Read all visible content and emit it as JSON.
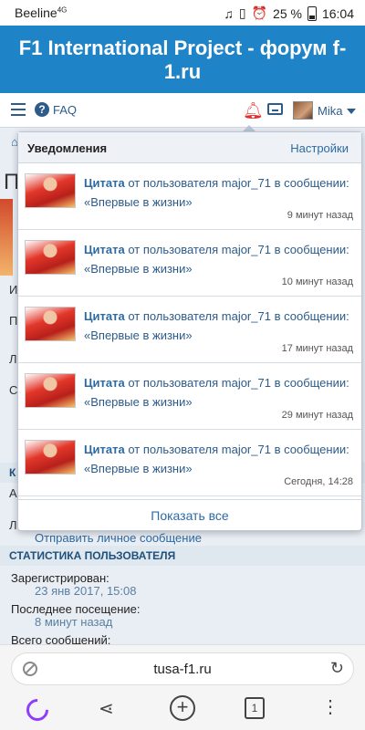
{
  "status_bar": {
    "carrier": "Beeline",
    "network": "4G",
    "battery": "25 %",
    "time": "16:04"
  },
  "header": {
    "title": "F1 International Project - форум f-1.ru"
  },
  "nav": {
    "faq": "FAQ",
    "username": "Mika",
    "icons": [
      "menu-icon",
      "help-circle-icon",
      "bell-icon",
      "inbox-icon",
      "avatar",
      "chevron-down-icon"
    ]
  },
  "page": {
    "peek_letters": [
      "П",
      "И",
      "П",
      "Л",
      "С",
      "К",
      "А",
      "Л"
    ],
    "send_pm": "Отправить личное сообщение",
    "stats_header": "Статистика пользователя",
    "registered_label": "Зарегистрирован:",
    "registered_value": "23 янв 2017, 15:08",
    "last_visit_label": "Последнее посещение:",
    "last_visit_value": "8 минут назад",
    "total_posts_label": "Всего сообщений:"
  },
  "notifications": {
    "title": "Уведомления",
    "settings": "Настройки",
    "show_all": "Показать все",
    "items": [
      {
        "kind": "Цитата",
        "text": "от пользователя major_71 в сообщении: «Впервые в жизни»",
        "time": "9 минут назад"
      },
      {
        "kind": "Цитата",
        "text": "от пользователя major_71 в сообщении: «Впервые в жизни»",
        "time": "10 минут назад"
      },
      {
        "kind": "Цитата",
        "text": "от пользователя major_71 в сообщении: «Впервые в жизни»",
        "time": "17 минут назад"
      },
      {
        "kind": "Цитата",
        "text": "от пользователя major_71 в сообщении: «Впервые в жизни»",
        "time": "29 минут назад"
      },
      {
        "kind": "Цитата",
        "text": "от пользователя major_71 в сообщении: «Впервые в жизни»",
        "time": "Сегодня, 14:28"
      }
    ]
  },
  "browser": {
    "url": "tusa-f1.ru",
    "tab_count": "1"
  },
  "colors": {
    "brand_blue": "#1e84c7",
    "link_blue": "#2d6aa3",
    "alert_red": "#e0302b",
    "assistant_purple": "#8f3cff"
  }
}
